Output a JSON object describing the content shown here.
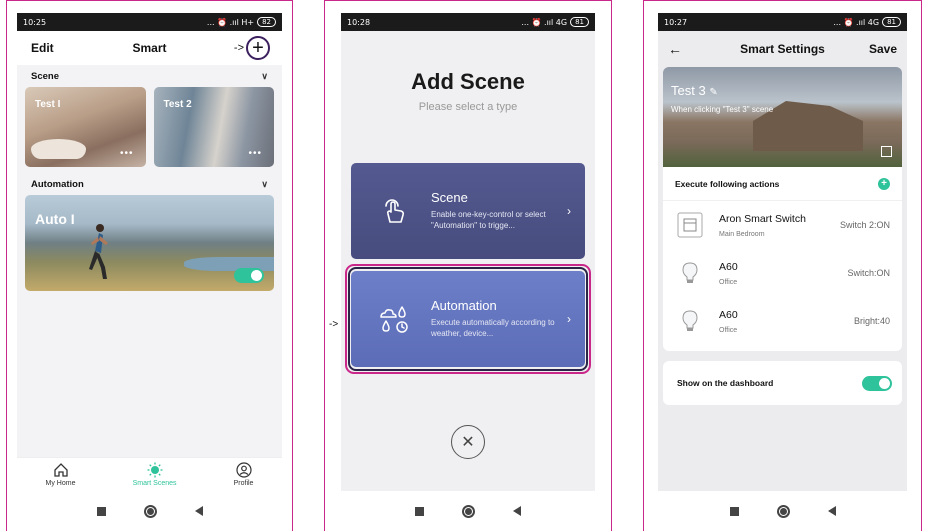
{
  "screen1": {
    "status": {
      "time": "10:25",
      "icons": "... ⏰ .ııl H+",
      "battery": "82"
    },
    "header": {
      "edit": "Edit",
      "title": "Smart",
      "arrow": "->",
      "plus": "+"
    },
    "scene_section": {
      "title": "Scene",
      "cards": [
        {
          "label": "Test I",
          "dots": "•••"
        },
        {
          "label": "Test 2",
          "dots": "•••"
        }
      ]
    },
    "automation_section": {
      "title": "Automation",
      "card_label": "Auto I",
      "toggle_on": true
    },
    "tabs": [
      {
        "label": "My Home"
      },
      {
        "label": "Smart Scenes"
      },
      {
        "label": "Profile"
      }
    ],
    "accent": "#2ec39a"
  },
  "screen2": {
    "status": {
      "time": "10:28",
      "icons": "... ⏰ .ııl 4G",
      "battery": "81"
    },
    "title": "Add Scene",
    "subtitle": "Please select a type",
    "scene": {
      "name": "Scene",
      "desc": "Enable one-key-control or select \"Automation\" to trigge..."
    },
    "automation": {
      "name": "Automation",
      "desc": "Execute automatically according to weather, device..."
    },
    "side_arrow": "->",
    "close": "✕"
  },
  "screen3": {
    "status": {
      "time": "10:27",
      "icons": "... ⏰ .ııl 4G",
      "battery": "81"
    },
    "header": {
      "back": "←",
      "title": "Smart Settings",
      "save": "Save"
    },
    "hero": {
      "name": "Test 3",
      "edit": "✎",
      "desc": "When clicking \"Test 3\" scene"
    },
    "actions_title": "Execute following actions",
    "add": "+",
    "actions": [
      {
        "name": "Aron Smart Switch",
        "room": "Main Bedroom",
        "state": "Switch 2:ON",
        "icon": "switch-icon"
      },
      {
        "name": "A60",
        "room": "Office",
        "state": "Switch:ON",
        "icon": "bulb-icon"
      },
      {
        "name": "A60",
        "room": "Office",
        "state": "Bright:40",
        "icon": "bulb-icon"
      }
    ],
    "dashboard_label": "Show on the dashboard",
    "dashboard_on": true
  }
}
